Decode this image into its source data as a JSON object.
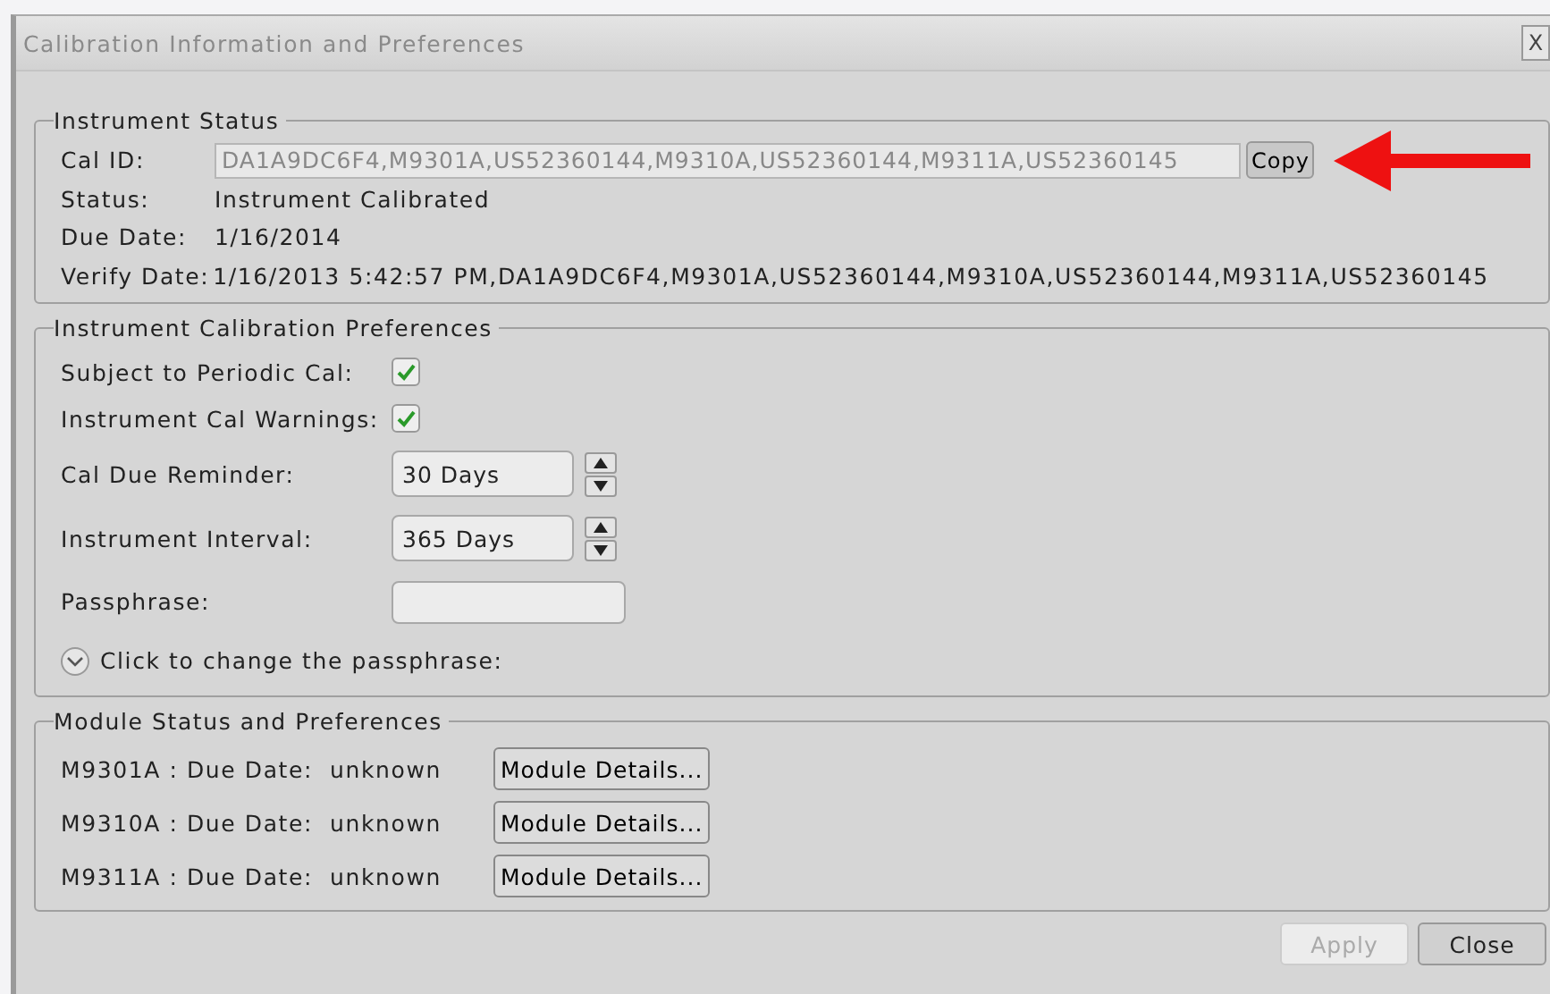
{
  "window": {
    "title": "Calibration Information and Preferences",
    "close": "X"
  },
  "instrument_status": {
    "title": "Instrument Status",
    "rows": [
      {
        "kind": "field",
        "label": "Cal ID:",
        "value": "DA1A9DC6F4,M9301A,US52360144,M9310A,US52360144,M9311A,US52360145",
        "button": "Copy"
      },
      {
        "kind": "text",
        "label": "Status:",
        "value": "Instrument Calibrated"
      },
      {
        "kind": "text",
        "label": "Due Date:",
        "value": "1/16/2014"
      },
      {
        "kind": "text",
        "label": "Verify Date:",
        "value": "1/16/2013 5:42:57 PM,DA1A9DC6F4,M9301A,US52360144,M9310A,US52360144,M9311A,US52360145"
      }
    ]
  },
  "calibration_preferences": {
    "title": "Instrument Calibration Preferences",
    "items": [
      {
        "kind": "checkbox",
        "label": "Subject to Periodic Cal:",
        "checked": true
      },
      {
        "kind": "checkbox",
        "label": "Instrument Cal Warnings:",
        "checked": true
      },
      {
        "kind": "spinner",
        "label": "Cal Due Reminder:",
        "value": "30 Days"
      },
      {
        "kind": "spinner",
        "label": "Instrument Interval:",
        "value": "365 Days"
      },
      {
        "kind": "password",
        "label": "Passphrase:"
      },
      {
        "kind": "expander",
        "label": "Click to change the passphrase:",
        "expanded": false
      }
    ]
  },
  "module_status": {
    "title": "Module Status and Preferences",
    "modules": [
      {
        "label": "M9301A : Due Date:  unknown",
        "button": "Module Details..."
      },
      {
        "label": "M9310A : Due Date:  unknown",
        "button": "Module Details..."
      },
      {
        "label": "M9311A : Due Date:  unknown",
        "button": "Module Details..."
      }
    ]
  },
  "buttons": [
    {
      "label": "Apply",
      "disabled": true
    },
    {
      "label": "Close",
      "disabled": false
    }
  ]
}
